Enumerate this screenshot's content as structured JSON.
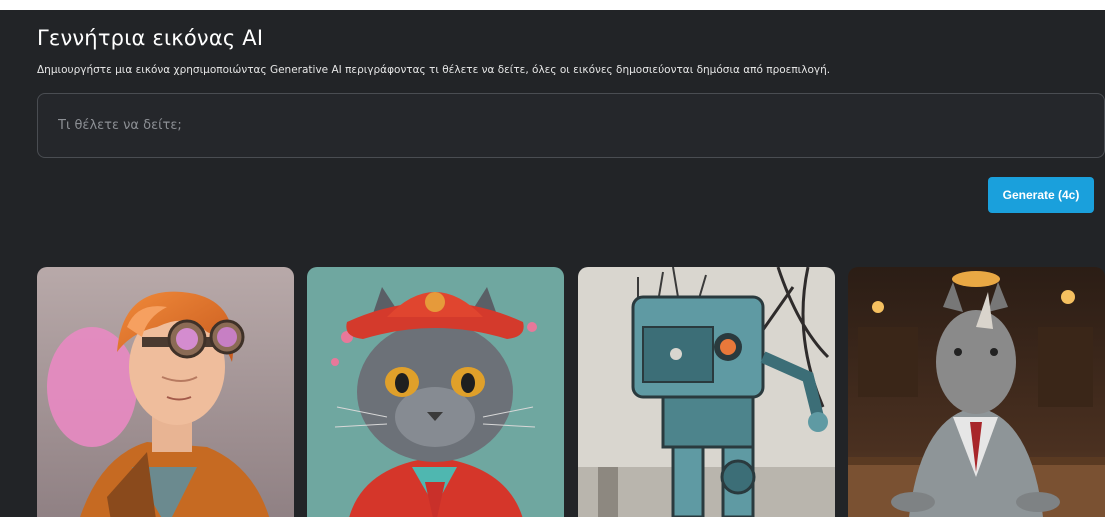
{
  "page": {
    "title": "Γεννήτρια εικόνας AI",
    "subtitle": "Δημιουργήστε μια εικόνα χρησιμοποιώντας Generative AI περιγράφοντας τι θέλετε να δείτε, όλες οι εικόνες δημοσιεύονται δημόσια από προεπιλογή."
  },
  "prompt": {
    "placeholder": "Τι θέλετε να δείτε;",
    "value": ""
  },
  "generate_button": {
    "label": "Generate (4c)"
  },
  "colors": {
    "background": "#222427",
    "accent": "#1aa0dc"
  },
  "gallery": [
    {
      "subject": "steampunk-aviator-portrait"
    },
    {
      "subject": "cat-in-red-hat-portrait"
    },
    {
      "subject": "teal-robot-illustration"
    },
    {
      "subject": "rhino-in-suit-bar-portrait"
    }
  ]
}
